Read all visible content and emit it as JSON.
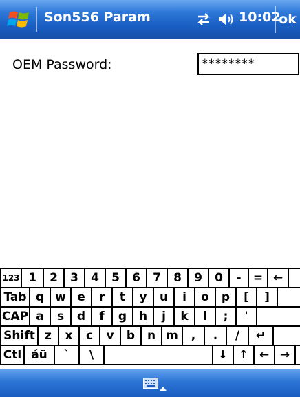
{
  "titlebar": {
    "title": "Son556 Param",
    "time": "10:02",
    "ok_label": "ok"
  },
  "form": {
    "password_label": "OEM Password:",
    "password_value": "********"
  },
  "keyboard": {
    "rows": [
      [
        "123",
        "1",
        "2",
        "3",
        "4",
        "5",
        "6",
        "7",
        "8",
        "9",
        "0",
        "-",
        "=",
        "←"
      ],
      [
        "Tab",
        "q",
        "w",
        "e",
        "r",
        "t",
        "y",
        "u",
        "i",
        "o",
        "p",
        "[",
        "]"
      ],
      [
        "CAP",
        "a",
        "s",
        "d",
        "f",
        "g",
        "h",
        "j",
        "k",
        "l",
        ";",
        "'"
      ],
      [
        "Shift",
        "z",
        "x",
        "c",
        "v",
        "b",
        "n",
        "m",
        ",",
        ".",
        "/",
        "↵"
      ],
      [
        "Ctl",
        "áü",
        "`",
        "\\",
        "",
        "↓",
        "↑",
        "←",
        "→"
      ]
    ]
  },
  "colors": {
    "bar_blue": "#1a5fc4",
    "text": "#000000",
    "background": "#ffffff"
  },
  "icons": [
    "windows-start-icon",
    "connectivity-icon",
    "volume-icon",
    "keyboard-icon",
    "chevron-up-icon"
  ]
}
